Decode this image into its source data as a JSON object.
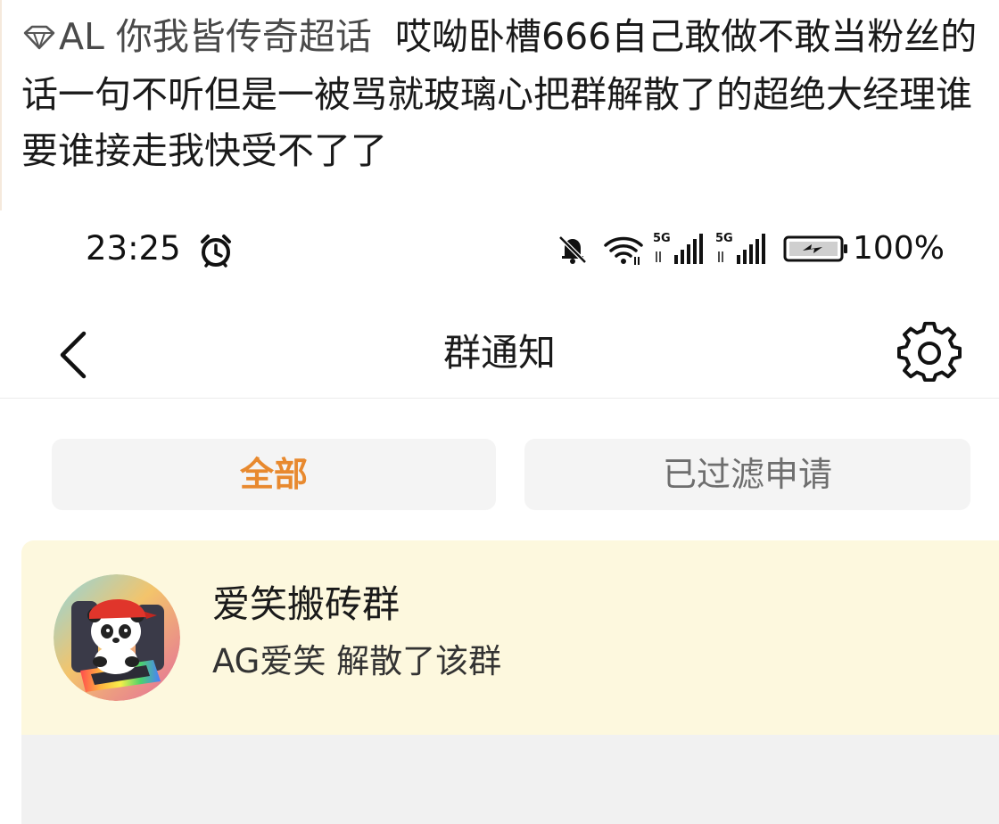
{
  "caption": {
    "lead": "AL 你我皆传奇超话",
    "text": "哎呦卧槽666自己敢做不敢当粉丝的话一句不听但是一被骂就玻璃心把群解散了的超绝大经理谁要谁接走我快受不了了"
  },
  "status_bar": {
    "time": "23:25",
    "network_1": "5G",
    "network_2": "5G",
    "battery": "100%"
  },
  "nav": {
    "title": "群通知"
  },
  "tabs": [
    {
      "label": "全部",
      "active": true
    },
    {
      "label": "已过滤申请",
      "active": false
    }
  ],
  "notice": {
    "group_name": "爱笑搬砖群",
    "message": "AG爱笑 解散了该群"
  },
  "colors": {
    "active_tab": "#e8892e",
    "notice_background": "#fdf8de",
    "tab_background": "#f4f4f4"
  },
  "icons": [
    "diamond-icon",
    "alarm-icon",
    "mute-icon",
    "wifi-icon",
    "signal-icon",
    "battery-icon",
    "back-icon",
    "gear-icon"
  ]
}
